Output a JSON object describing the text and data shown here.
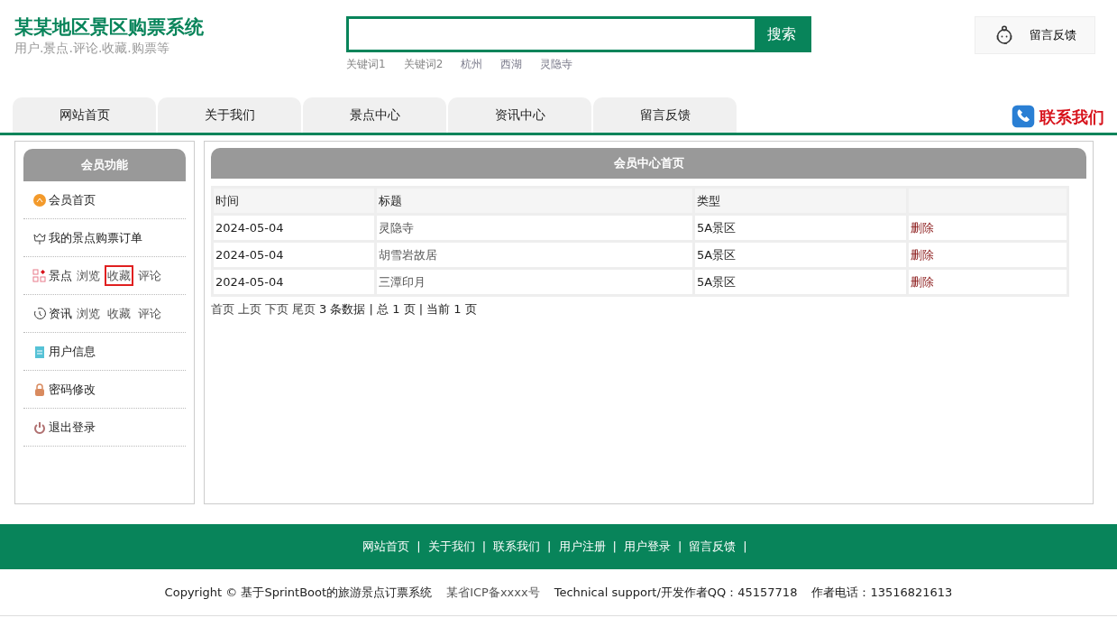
{
  "site": {
    "title": "某某地区景区购票系统",
    "subtitle": "用户.景点.评论.收藏.购票等"
  },
  "search": {
    "button": "搜索",
    "keywords": [
      "关键词1",
      "关键词2",
      "杭州",
      "西湖",
      "灵隐寺"
    ]
  },
  "feedback_button": "留言反馈",
  "nav_tabs": [
    "网站首页",
    "关于我们",
    "景点中心",
    "资讯中心",
    "留言反馈"
  ],
  "contact": "联系我们",
  "sidebar": {
    "title": "会员功能",
    "items": [
      {
        "kind": "link",
        "label": "会员首页"
      },
      {
        "kind": "link",
        "label": "我的景点购票订单"
      },
      {
        "kind": "group",
        "label": "景点",
        "links": [
          {
            "label": "浏览",
            "highlighted": false
          },
          {
            "label": "收藏",
            "highlighted": true
          },
          {
            "label": "评论",
            "highlighted": false
          }
        ]
      },
      {
        "kind": "group",
        "label": "资讯",
        "links": [
          {
            "label": "浏览",
            "highlighted": false
          },
          {
            "label": "收藏",
            "highlighted": false
          },
          {
            "label": "评论",
            "highlighted": false
          }
        ]
      },
      {
        "kind": "link",
        "label": "用户信息"
      },
      {
        "kind": "link",
        "label": "密码修改"
      },
      {
        "kind": "link",
        "label": "退出登录"
      }
    ]
  },
  "main": {
    "title": "会员中心首页",
    "table": {
      "columns": [
        "时间",
        "标题",
        "类型"
      ],
      "rows": [
        {
          "time": "2024-05-04",
          "title": "灵隐寺",
          "type": "5A景区",
          "action": "删除"
        },
        {
          "time": "2024-05-04",
          "title": "胡雪岩故居",
          "type": "5A景区",
          "action": "删除"
        },
        {
          "time": "2024-05-04",
          "title": "三潭印月",
          "type": "5A景区",
          "action": "删除"
        }
      ]
    },
    "pagination": {
      "links": [
        "首页",
        "上页",
        "下页",
        "尾页"
      ],
      "summary": "3 条数据 | 总 1 页 | 当前 1 页"
    }
  },
  "footer": {
    "links": [
      "网站首页",
      "关于我们",
      "联系我们",
      "用户注册",
      "用户登录",
      "留言反馈"
    ],
    "separator": "|",
    "copyright": "Copyright © 基于SprintBoot的旅游景点订票系统",
    "icp": "某省ICP备xxxx号",
    "support": "Technical support/开发作者QQ：45157718",
    "phone": "作者电话：13516821613"
  }
}
